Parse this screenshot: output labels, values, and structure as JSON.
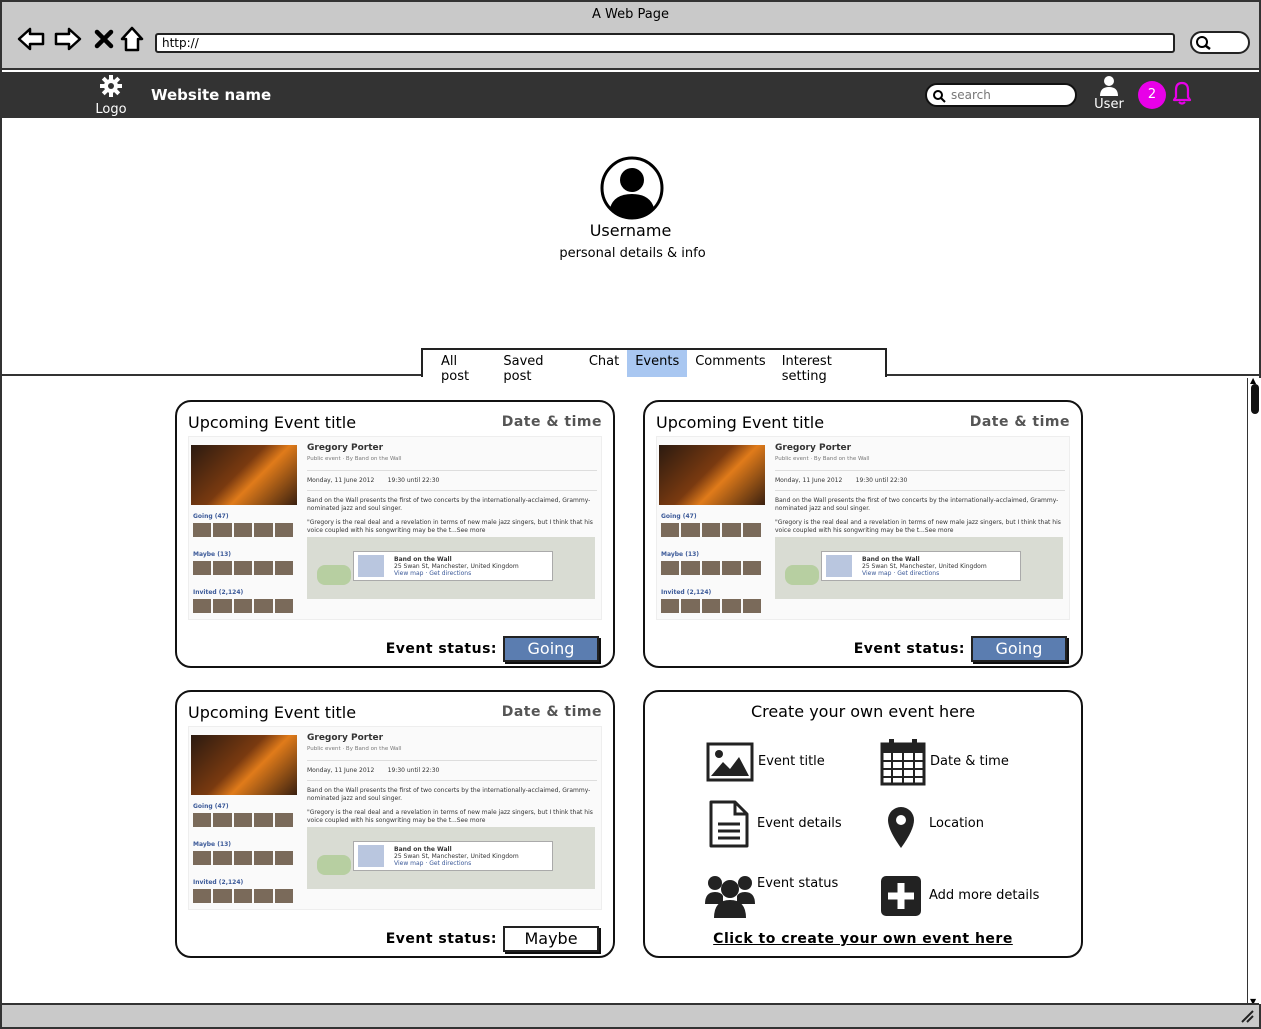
{
  "browser": {
    "window_title": "A Web Page",
    "url": "http://"
  },
  "header": {
    "logo_label": "Logo",
    "site_name": "Website name",
    "search_placeholder": "search",
    "user_label": "User",
    "notification_count": "2",
    "accent_color": "#e800e8"
  },
  "profile": {
    "username": "Username",
    "details": "personal details & info"
  },
  "tabs": [
    {
      "label": "All post",
      "active": false
    },
    {
      "label": "Saved post",
      "active": false
    },
    {
      "label": "Chat",
      "active": false
    },
    {
      "label": "Events",
      "active": true
    },
    {
      "label": "Comments",
      "active": false
    },
    {
      "label": "Interest setting",
      "active": false
    }
  ],
  "preview": {
    "name": "Gregory Porter",
    "subtitle": "Public event · By Band on the Wall",
    "date": "Monday, 11 June 2012",
    "time": "19:30 until 22:30",
    "description": "Band on the Wall presents the first of two concerts by the internationally-acclaimed, Grammy-nominated jazz and soul singer.",
    "quote": "\"Gregory is the real deal and a revelation in terms of new male jazz singers, but I think that his voice coupled with his songwriting may be the t...See more",
    "going": "Going (47)",
    "maybe": "Maybe (13)",
    "invited": "Invited (2,124)",
    "venue": "Band on the Wall",
    "address": "25 Swan St, Manchester, United Kingdom",
    "links": "View map · Get directions"
  },
  "events": [
    {
      "title": "Upcoming Event title",
      "date": "Date & time",
      "status_label": "Event status:",
      "status": "Going"
    },
    {
      "title": "Upcoming Event title",
      "date": "Date & time",
      "status_label": "Event status:",
      "status": "Going"
    },
    {
      "title": "Upcoming Event title",
      "date": "Date & time",
      "status_label": "Event status:",
      "status": "Maybe"
    }
  ],
  "create": {
    "title": "Create your own event here",
    "items": {
      "event_title": "Event title",
      "date_time": "Date & time",
      "event_details": "Event details",
      "location": "Location",
      "event_status": "Event status",
      "add_more": "Add more details"
    },
    "link": "Click to create your own event here"
  },
  "colors": {
    "active_tab": "#a9c7f1",
    "going_button": "#5b7db0",
    "header_bg": "#333333"
  }
}
